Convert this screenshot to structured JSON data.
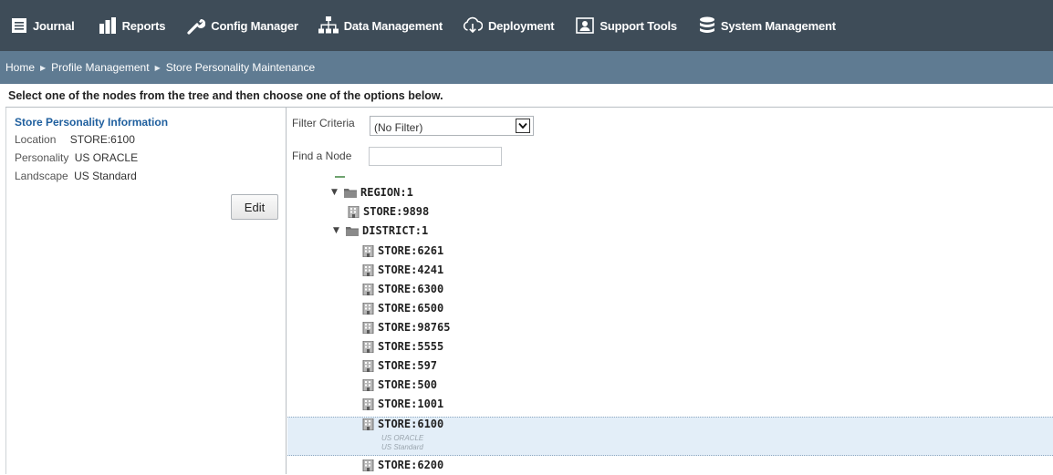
{
  "nav": {
    "items": [
      {
        "label": "Journal",
        "icon": "journal-icon"
      },
      {
        "label": "Reports",
        "icon": "bar-chart-icon"
      },
      {
        "label": "Config Manager",
        "icon": "wrench-icon"
      },
      {
        "label": "Data Management",
        "icon": "hierarchy-icon"
      },
      {
        "label": "Deployment",
        "icon": "cloud-download-icon"
      },
      {
        "label": "Support Tools",
        "icon": "support-person-icon"
      },
      {
        "label": "System Management",
        "icon": "database-icon"
      }
    ]
  },
  "breadcrumb": {
    "items": [
      "Home",
      "Profile Management",
      "Store Personality Maintenance"
    ],
    "separator": "▶"
  },
  "instruction": "Select one of the nodes from the tree and then choose one of the options below.",
  "info": {
    "title": "Store Personality Information",
    "location_label": "Location",
    "location_value": "STORE:6100",
    "personality_label": "Personality",
    "personality_value": "US ORACLE",
    "landscape_label": "Landscape",
    "landscape_value": "US Standard",
    "edit_label": "Edit"
  },
  "filter": {
    "label": "Filter Criteria",
    "selected": "(No Filter)",
    "find_label": "Find a Node",
    "find_value": ""
  },
  "tree": {
    "region": {
      "label": "REGION:1",
      "expanded": true
    },
    "region_store": "STORE:9898",
    "district": {
      "label": "DISTRICT:1",
      "expanded": true
    },
    "stores": [
      "STORE:6261",
      "STORE:4241",
      "STORE:6300",
      "STORE:6500",
      "STORE:98765",
      "STORE:5555",
      "STORE:597",
      "STORE:500",
      "STORE:1001",
      "STORE:6100",
      "STORE:6200"
    ],
    "selected": "STORE:6100",
    "selected_personality": "US ORACLE",
    "selected_landscape": "US Standard"
  },
  "colors": {
    "topnav": "#3e4c58",
    "breadcrumb_bar": "#5f7b92",
    "info_title": "#1f5f9e",
    "selection": "#e3eef8"
  }
}
